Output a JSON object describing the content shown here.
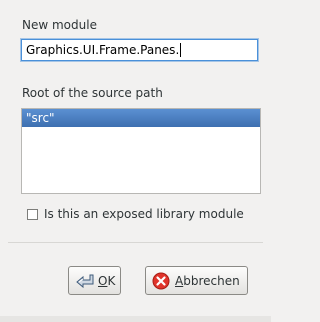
{
  "dialog": {
    "new_module_label": "New module",
    "module_value": "Graphics.UI.Frame.Panes.",
    "root_label": "Root of the source path",
    "source_paths": [
      "\"src\""
    ],
    "selected_source_path_index": 0,
    "exposed_checkbox_label": "Is this an exposed library module",
    "exposed_checked": false
  },
  "buttons": {
    "ok_mnemonic": "O",
    "ok_rest": "K",
    "cancel_mnemonic": "A",
    "cancel_rest": "bbrechen"
  },
  "icons": {
    "ok": "ok-apply-icon",
    "cancel": "cancel-icon"
  },
  "colors": {
    "selection": "#4a7fc1",
    "focus": "#4a90d9",
    "cancel_icon": "#e0342b"
  }
}
